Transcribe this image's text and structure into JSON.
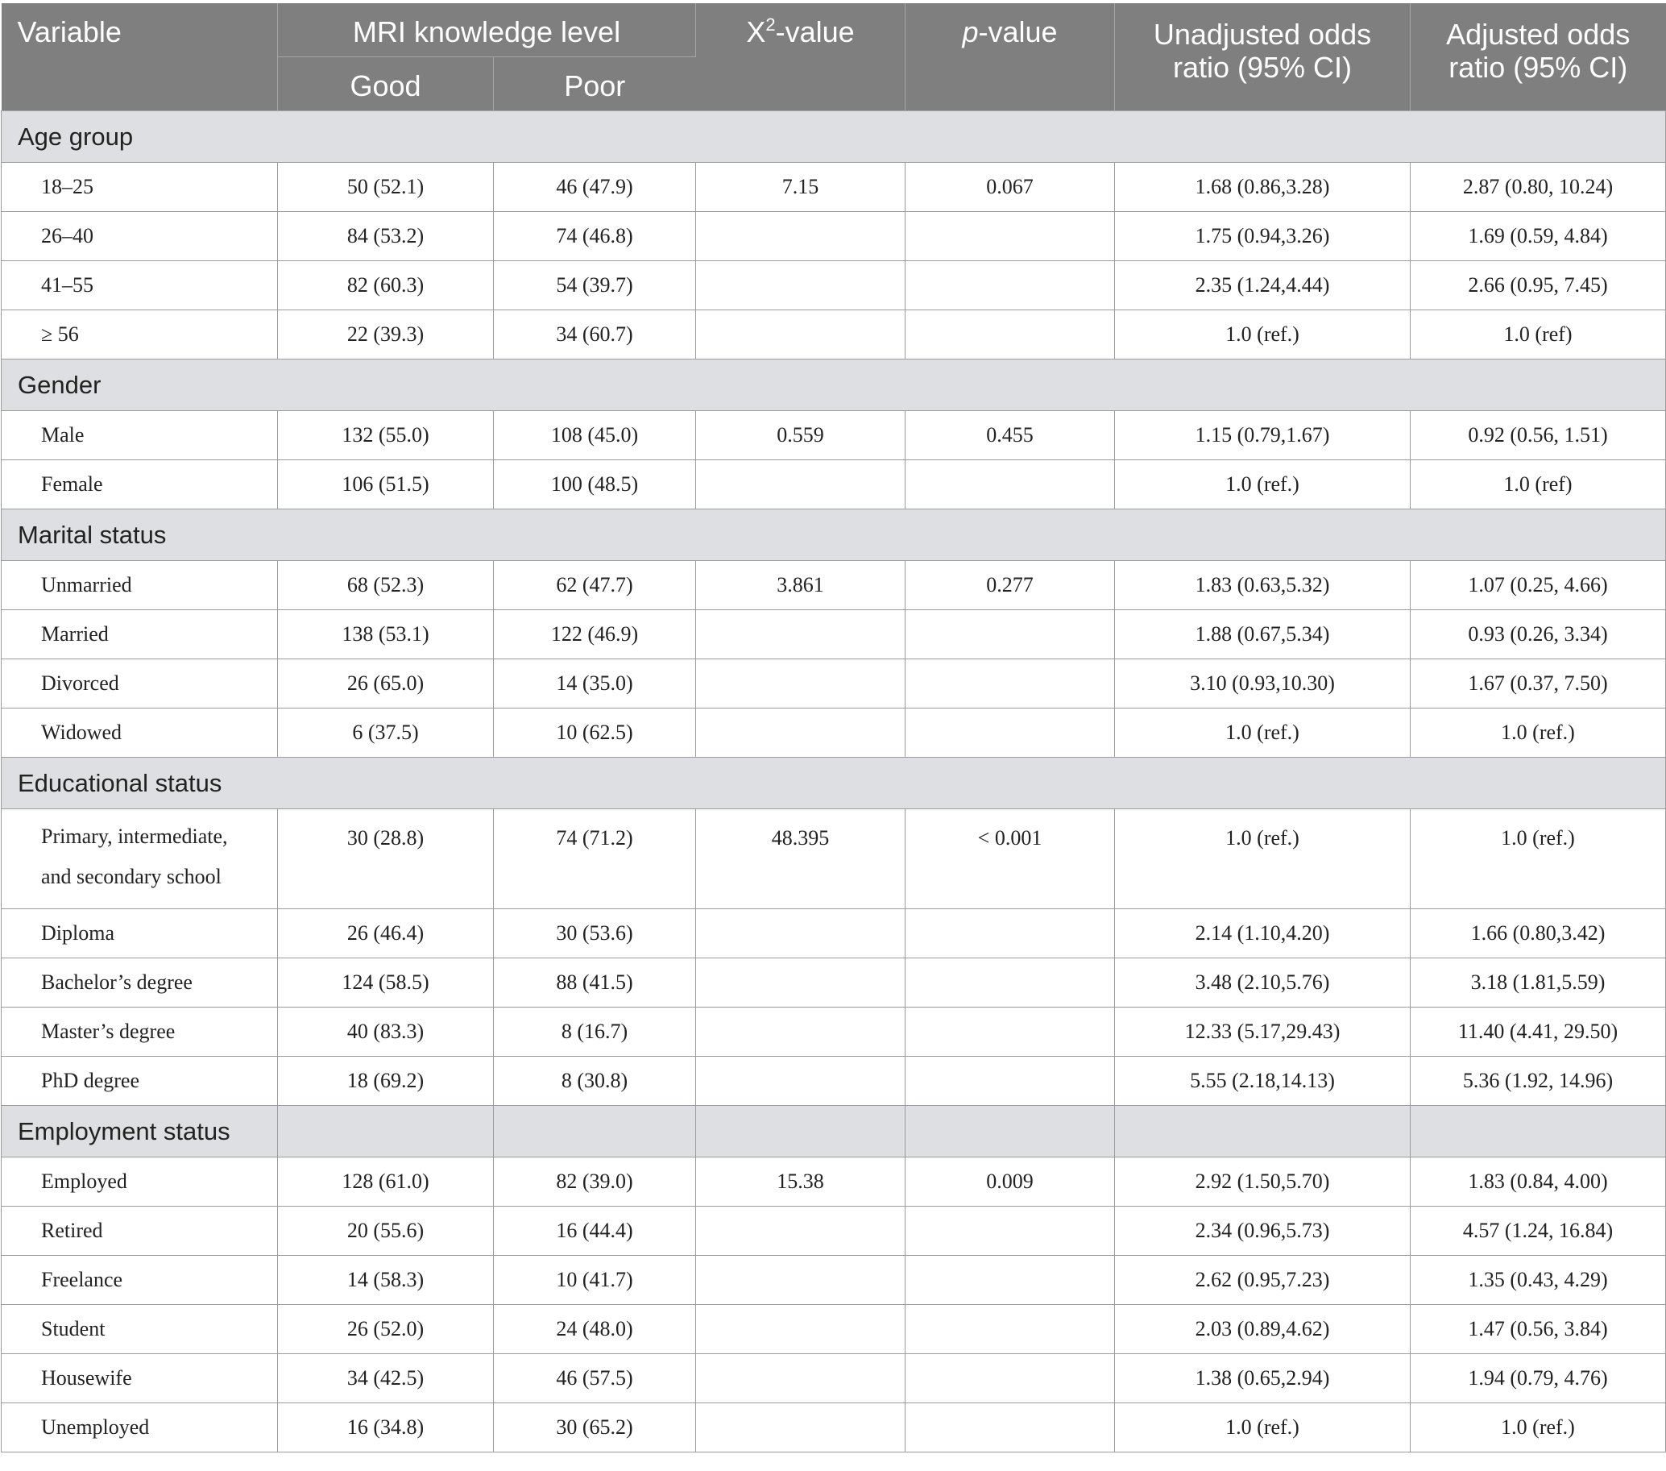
{
  "header": {
    "variable": "Variable",
    "knowledge_level": "MRI knowledge level",
    "good": "Good",
    "poor": "Poor",
    "chi_base": "X",
    "chi_sup": "2",
    "chi_suffix": "-value",
    "p_italic": "p",
    "p_suffix": "-value",
    "unadjusted_line1": "Unadjusted odds",
    "unadjusted_line2": "ratio (95% CI)",
    "adjusted_line1": "Adjusted odds",
    "adjusted_line2": "ratio (95% CI)"
  },
  "sections": [
    {
      "title": "Age group",
      "rows": [
        {
          "label": "18–25",
          "good": "50 (52.1)",
          "poor": "46 (47.9)",
          "chi": "7.15",
          "p": "0.067",
          "unadj": "1.68 (0.86,3.28)",
          "adj": "2.87 (0.80, 10.24)"
        },
        {
          "label": "26–40",
          "good": "84 (53.2)",
          "poor": "74 (46.8)",
          "chi": "",
          "p": "",
          "unadj": "1.75 (0.94,3.26)",
          "adj": "1.69 (0.59, 4.84)"
        },
        {
          "label": "41–55",
          "good": "82 (60.3)",
          "poor": "54 (39.7)",
          "chi": "",
          "p": "",
          "unadj": "2.35 (1.24,4.44)",
          "adj": "2.66 (0.95, 7.45)"
        },
        {
          "label": "≥ 56",
          "good": "22 (39.3)",
          "poor": "34 (60.7)",
          "chi": "",
          "p": "",
          "unadj": "1.0 (ref.)",
          "adj": "1.0 (ref)"
        }
      ]
    },
    {
      "title": "Gender",
      "rows": [
        {
          "label": "Male",
          "good": "132 (55.0)",
          "poor": "108 (45.0)",
          "chi": "0.559",
          "p": "0.455",
          "unadj": "1.15 (0.79,1.67)",
          "adj": "0.92 (0.56, 1.51)"
        },
        {
          "label": "Female",
          "good": "106 (51.5)",
          "poor": "100 (48.5)",
          "chi": "",
          "p": "",
          "unadj": "1.0 (ref.)",
          "adj": "1.0 (ref)"
        }
      ]
    },
    {
      "title": "Marital status",
      "rows": [
        {
          "label": "Unmarried",
          "good": "68 (52.3)",
          "poor": "62 (47.7)",
          "chi": "3.861",
          "p": "0.277",
          "unadj": "1.83 (0.63,5.32)",
          "adj": "1.07 (0.25, 4.66)"
        },
        {
          "label": "Married",
          "good": "138 (53.1)",
          "poor": "122 (46.9)",
          "chi": "",
          "p": "",
          "unadj": "1.88 (0.67,5.34)",
          "adj": "0.93 (0.26, 3.34)"
        },
        {
          "label": "Divorced",
          "good": "26 (65.0)",
          "poor": "14 (35.0)",
          "chi": "",
          "p": "",
          "unadj": "3.10 (0.93,10.30)",
          "adj": "1.67 (0.37, 7.50)"
        },
        {
          "label": "Widowed",
          "good": "6 (37.5)",
          "poor": "10 (62.5)",
          "chi": "",
          "p": "",
          "unadj": "1.0 (ref.)",
          "adj": "1.0 (ref.)"
        }
      ]
    },
    {
      "title": "Educational status",
      "rows": [
        {
          "label": "Primary, intermediate,",
          "label2": "and secondary school",
          "good": "30 (28.8)",
          "poor": "74 (71.2)",
          "chi": "48.395",
          "p": "< 0.001",
          "unadj": "1.0 (ref.)",
          "adj": "1.0 (ref.)"
        },
        {
          "label": "Diploma",
          "good": "26 (46.4)",
          "poor": "30 (53.6)",
          "chi": "",
          "p": "",
          "unadj": "2.14 (1.10,4.20)",
          "adj": "1.66 (0.80,3.42)"
        },
        {
          "label": "Bachelor’s degree",
          "good": "124 (58.5)",
          "poor": "88 (41.5)",
          "chi": "",
          "p": "",
          "unadj": "3.48 (2.10,5.76)",
          "adj": "3.18 (1.81,5.59)"
        },
        {
          "label": "Master’s degree",
          "good": "40 (83.3)",
          "poor": "8 (16.7)",
          "chi": "",
          "p": "",
          "unadj": "12.33 (5.17,29.43)",
          "adj": "11.40 (4.41, 29.50)"
        },
        {
          "label": "PhD degree",
          "good": "18 (69.2)",
          "poor": "8 (30.8)",
          "chi": "",
          "p": "",
          "unadj": "5.55 (2.18,14.13)",
          "adj": "5.36 (1.92, 14.96)"
        }
      ]
    },
    {
      "title": "Employment status",
      "rows": [
        {
          "label": "Employed",
          "good": "128 (61.0)",
          "poor": "82 (39.0)",
          "chi": "15.38",
          "p": "0.009",
          "unadj": "2.92 (1.50,5.70)",
          "adj": "1.83 (0.84, 4.00)"
        },
        {
          "label": "Retired",
          "good": "20 (55.6)",
          "poor": "16 (44.4)",
          "chi": "",
          "p": "",
          "unadj": "2.34 (0.96,5.73)",
          "adj": "4.57 (1.24, 16.84)"
        },
        {
          "label": "Freelance",
          "good": "14 (58.3)",
          "poor": "10 (41.7)",
          "chi": "",
          "p": "",
          "unadj": "2.62 (0.95,7.23)",
          "adj": "1.35 (0.43, 4.29)"
        },
        {
          "label": "Student",
          "good": "26 (52.0)",
          "poor": "24 (48.0)",
          "chi": "",
          "p": "",
          "unadj": "2.03 (0.89,4.62)",
          "adj": "1.47 (0.56, 3.84)"
        },
        {
          "label": "Housewife",
          "good": "34 (42.5)",
          "poor": "46 (57.5)",
          "chi": "",
          "p": "",
          "unadj": "1.38 (0.65,2.94)",
          "adj": "1.94 (0.79, 4.76)"
        },
        {
          "label": "Unemployed",
          "good": "16 (34.8)",
          "poor": "30 (65.2)",
          "chi": "",
          "p": "",
          "unadj": "1.0 (ref.)",
          "adj": "1.0 (ref.)"
        }
      ]
    }
  ]
}
